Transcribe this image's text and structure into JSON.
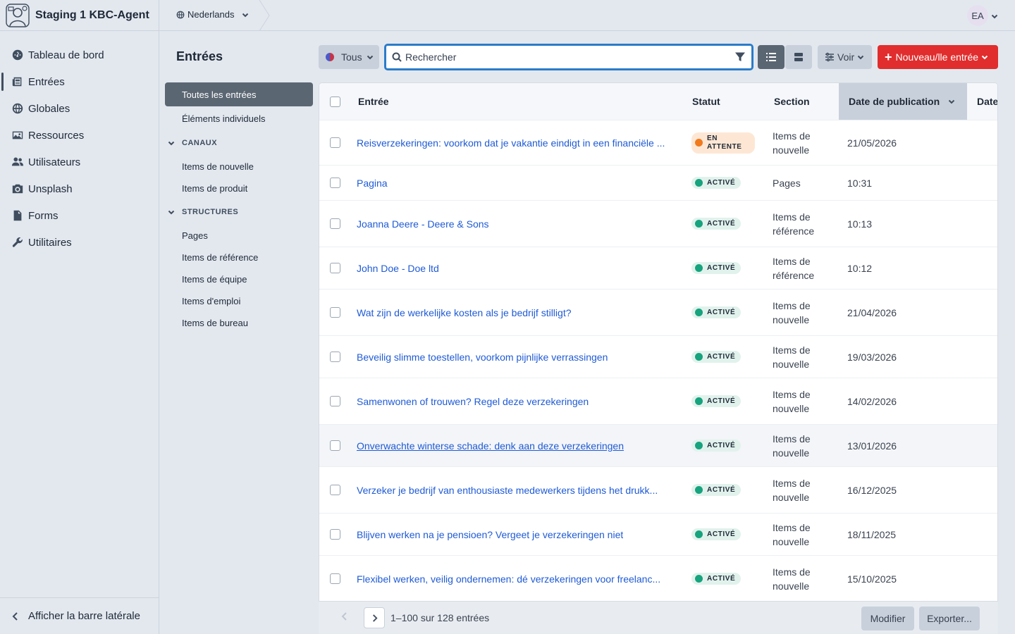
{
  "app": {
    "title": "Staging 1 KBC-Agent"
  },
  "topbar": {
    "site": "Nederlands",
    "avatar": "EA"
  },
  "nav": {
    "items": [
      {
        "label": "Tableau de bord",
        "icon": "dashboard-icon"
      },
      {
        "label": "Entrées",
        "icon": "newspaper-icon",
        "active": true
      },
      {
        "label": "Globales",
        "icon": "globe-icon"
      },
      {
        "label": "Ressources",
        "icon": "image-icon"
      },
      {
        "label": "Utilisateurs",
        "icon": "users-icon"
      },
      {
        "label": "Unsplash",
        "icon": "camera-icon"
      },
      {
        "label": "Forms",
        "icon": "file-icon"
      },
      {
        "label": "Utilitaires",
        "icon": "wrench-icon"
      }
    ],
    "footer": "Afficher la barre latérale"
  },
  "page": {
    "title": "Entrées"
  },
  "sources": {
    "all": "Toutes les entrées",
    "singles": "Éléments individuels",
    "channels_heading": "CANAUX",
    "channels": [
      "Items de nouvelle",
      "Items de produit"
    ],
    "structures_heading": "STRUCTURES",
    "structures": [
      "Pages",
      "Items de référence",
      "Items de équipe",
      "Items d'emploi",
      "Items de bureau"
    ]
  },
  "toolbar": {
    "site_filter": "Tous",
    "search_placeholder": "Rechercher",
    "view_label": "Voir",
    "new_label": "Nouveau/lle entrée"
  },
  "table": {
    "columns": {
      "entry": "Entrée",
      "status": "Statut",
      "section": "Section",
      "post_date": "Date de publication",
      "extra": "Date"
    },
    "rows": [
      {
        "title": "Reisverzekeringen: voorkom dat je vakantie eindigt in een financiële ...",
        "status": "EN ATTENTE",
        "status_type": "pending",
        "section": "Items de nouvelle",
        "date": "21/05/2026"
      },
      {
        "title": "Pagina",
        "status": "ACTIVÉ",
        "status_type": "live",
        "section": "Pages",
        "date": "10:31"
      },
      {
        "title": "Joanna Deere - Deere & Sons",
        "status": "ACTIVÉ",
        "status_type": "live",
        "section": "Items de référence",
        "date": "10:13"
      },
      {
        "title": "John Doe - Doe ltd",
        "status": "ACTIVÉ",
        "status_type": "live",
        "section": "Items de référence",
        "date": "10:12"
      },
      {
        "title": "Wat zijn de werkelijke kosten als je bedrijf stilligt?",
        "status": "ACTIVÉ",
        "status_type": "live",
        "section": "Items de nouvelle",
        "date": "21/04/2026"
      },
      {
        "title": "Beveilig slimme toestellen, voorkom pijnlijke verrassingen",
        "status": "ACTIVÉ",
        "status_type": "live",
        "section": "Items de nouvelle",
        "date": "19/03/2026"
      },
      {
        "title": "Samenwonen of trouwen? Regel deze verzekeringen",
        "status": "ACTIVÉ",
        "status_type": "live",
        "section": "Items de nouvelle",
        "date": "14/02/2026"
      },
      {
        "title": "Onverwachte winterse schade: denk aan deze verzekeringen",
        "status": "ACTIVÉ",
        "status_type": "live",
        "section": "Items de nouvelle",
        "date": "13/01/2026",
        "hover": true
      },
      {
        "title": "Verzeker je bedrijf van enthousiaste medewerkers tijdens het drukk...",
        "status": "ACTIVÉ",
        "status_type": "live",
        "section": "Items de nouvelle",
        "date": "16/12/2025"
      },
      {
        "title": "Blijven werken na je pensioen? Vergeet je verzekeringen niet",
        "status": "ACTIVÉ",
        "status_type": "live",
        "section": "Items de nouvelle",
        "date": "18/11/2025"
      },
      {
        "title": "Flexibel werken, veilig ondernemen: dé verzekeringen voor freelanc...",
        "status": "ACTIVÉ",
        "status_type": "live",
        "section": "Items de nouvelle",
        "date": "15/10/2025"
      }
    ]
  },
  "pagination": {
    "summary": "1–100 sur 128 entrées"
  },
  "actions": {
    "edit": "Modifier",
    "export": "Exporter..."
  },
  "colors": {
    "accent_red": "#e12d2d",
    "link_blue": "#1f5bd6",
    "live_green": "#17a37d",
    "pending_orange": "#f07a1d",
    "focus_blue": "#2b7cc9"
  }
}
